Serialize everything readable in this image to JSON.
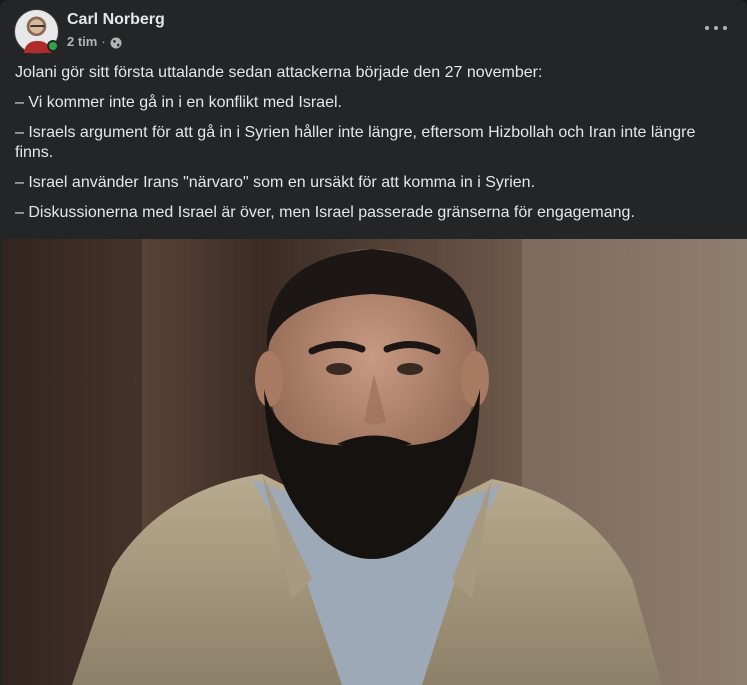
{
  "post": {
    "author": "Carl Norberg",
    "time": "2 tim",
    "separator": "·",
    "privacy_icon": "globe-icon",
    "more_icon": "more-options-icon",
    "paragraphs": [
      "Jolani gör sitt första uttalande sedan attackerna började den 27 november:",
      "– Vi kommer inte gå in i en konflikt med Israel.",
      "– Israels argument för att gå in i Syrien håller inte längre, eftersom Hizbollah och Iran inte längre finns.",
      "– Israel använder Irans \"närvaro\" som en ursäkt för att komma in i Syrien.",
      "– Diskussionerna med Israel är över, men Israel passerade gränserna för engagemang."
    ]
  },
  "colors": {
    "background": "#242526",
    "text_primary": "#e4e6eb",
    "text_secondary": "#b0b3b8",
    "online_status": "#31a24c"
  }
}
